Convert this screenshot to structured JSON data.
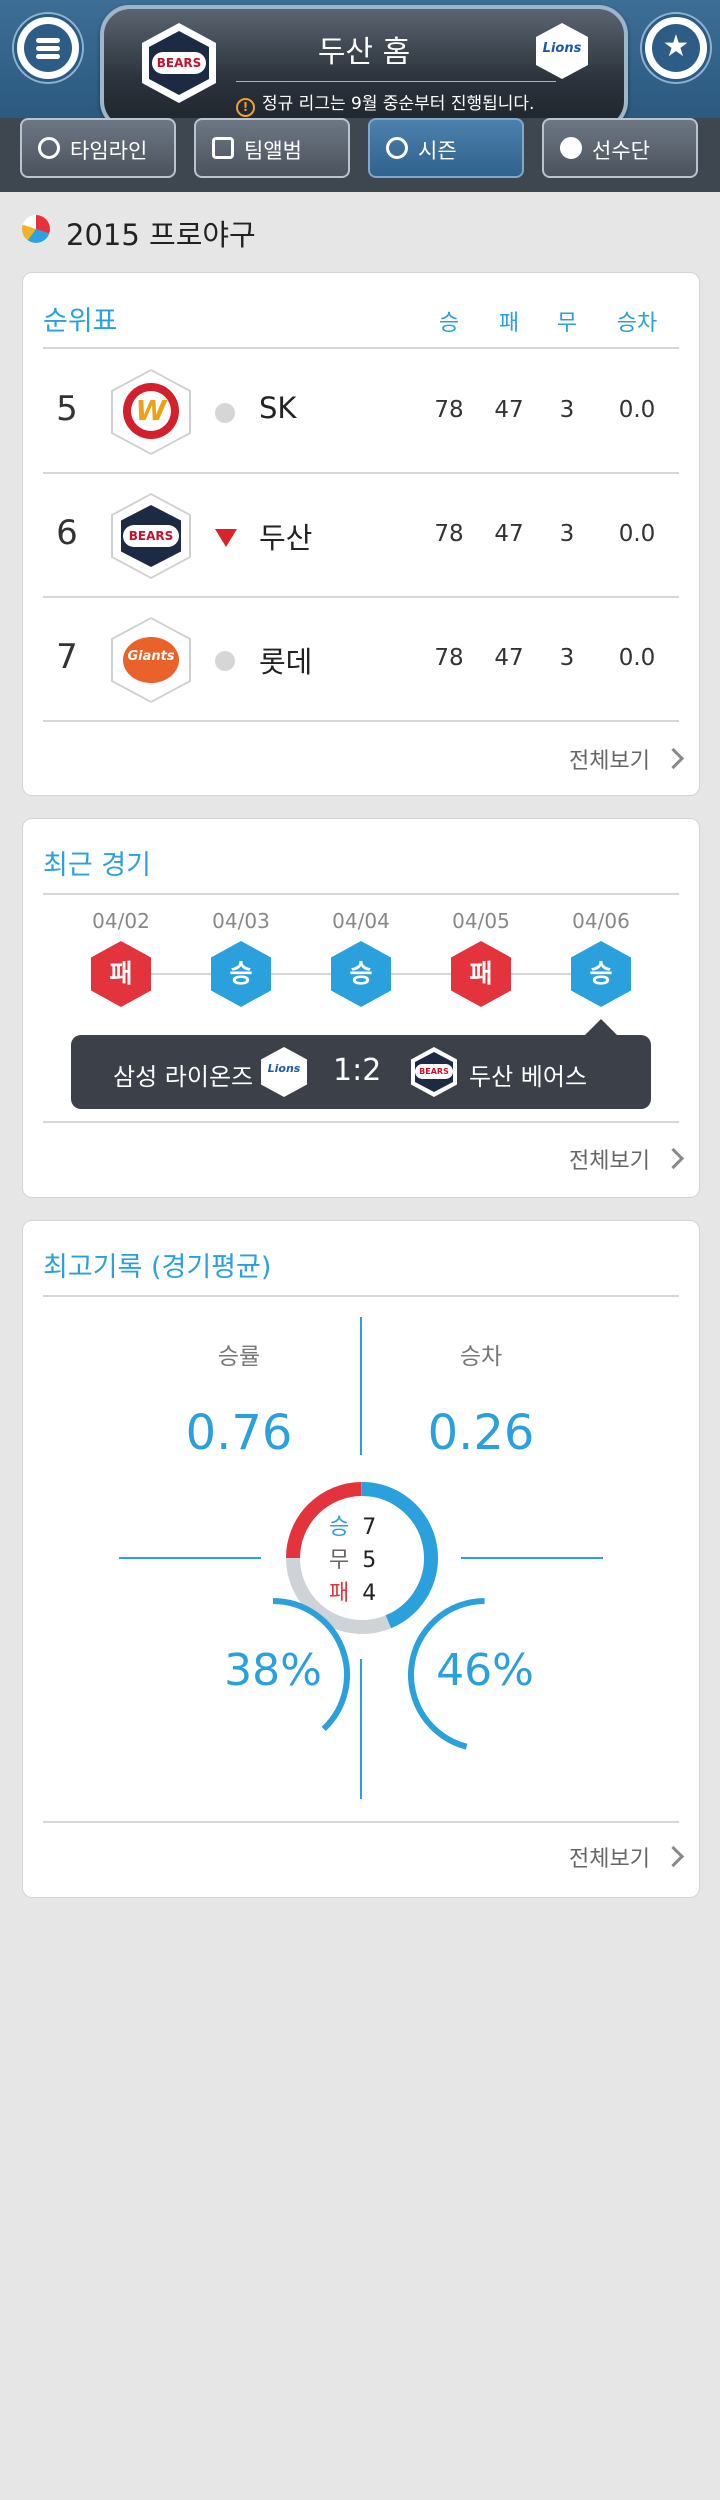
{
  "header": {
    "title": "두산 홈",
    "notice": "정규 리그는 9월 중순부터 진행됩니다.",
    "menu_icon": "hamburger-menu-icon",
    "favorite_icon": "star-icon",
    "home_team_logo": "BEARS",
    "away_team_logo": "Lions"
  },
  "tabs": [
    {
      "label": "타임라인",
      "icon": "clock-icon"
    },
    {
      "label": "팀앨범",
      "icon": "album-icon"
    },
    {
      "label": "시즌",
      "icon": "baseball-icon",
      "active": true
    },
    {
      "label": "선수단",
      "icon": "helmet-icon"
    }
  ],
  "section": {
    "title": "2015 프로야구"
  },
  "standings": {
    "title": "순위표",
    "columns": [
      "승",
      "패",
      "무",
      "승차"
    ],
    "rows": [
      {
        "rank": "5",
        "team": "SK",
        "logo": "W",
        "trend": "none",
        "w": "78",
        "l": "47",
        "d": "3",
        "gb": "0.0"
      },
      {
        "rank": "6",
        "team": "두산",
        "logo": "BEARS",
        "trend": "down",
        "w": "78",
        "l": "47",
        "d": "3",
        "gb": "0.0"
      },
      {
        "rank": "7",
        "team": "롯데",
        "logo": "Giants",
        "trend": "none",
        "w": "78",
        "l": "47",
        "d": "3",
        "gb": "0.0"
      }
    ],
    "more": "전체보기"
  },
  "recent": {
    "title": "최근 경기",
    "games": [
      {
        "date": "04/02",
        "result": "패"
      },
      {
        "date": "04/03",
        "result": "승"
      },
      {
        "date": "04/04",
        "result": "승"
      },
      {
        "date": "04/05",
        "result": "패"
      },
      {
        "date": "04/06",
        "result": "승"
      }
    ],
    "tooltip": {
      "away": "삼성 라이온즈",
      "score": "1:2",
      "home": "두산 베어스",
      "away_logo": "Lions",
      "home_logo": "BEARS"
    },
    "more": "전체보기"
  },
  "records": {
    "title": "최고기록 (경기평균)",
    "win_rate_label": "승률",
    "win_rate": "0.76",
    "gb_label": "승차",
    "gb": "0.26",
    "wins_label": "승",
    "wins": "7",
    "draws_label": "무",
    "draws": "5",
    "losses_label": "패",
    "losses": "4",
    "pct_left": "38%",
    "pct_right": "46%",
    "pct_left_value": 0.38,
    "pct_right_value": 0.46,
    "colors": {
      "win": "#2aa1dc",
      "loss": "#e3343d",
      "draw": "#cfd3d8"
    },
    "more": "전체보기"
  }
}
